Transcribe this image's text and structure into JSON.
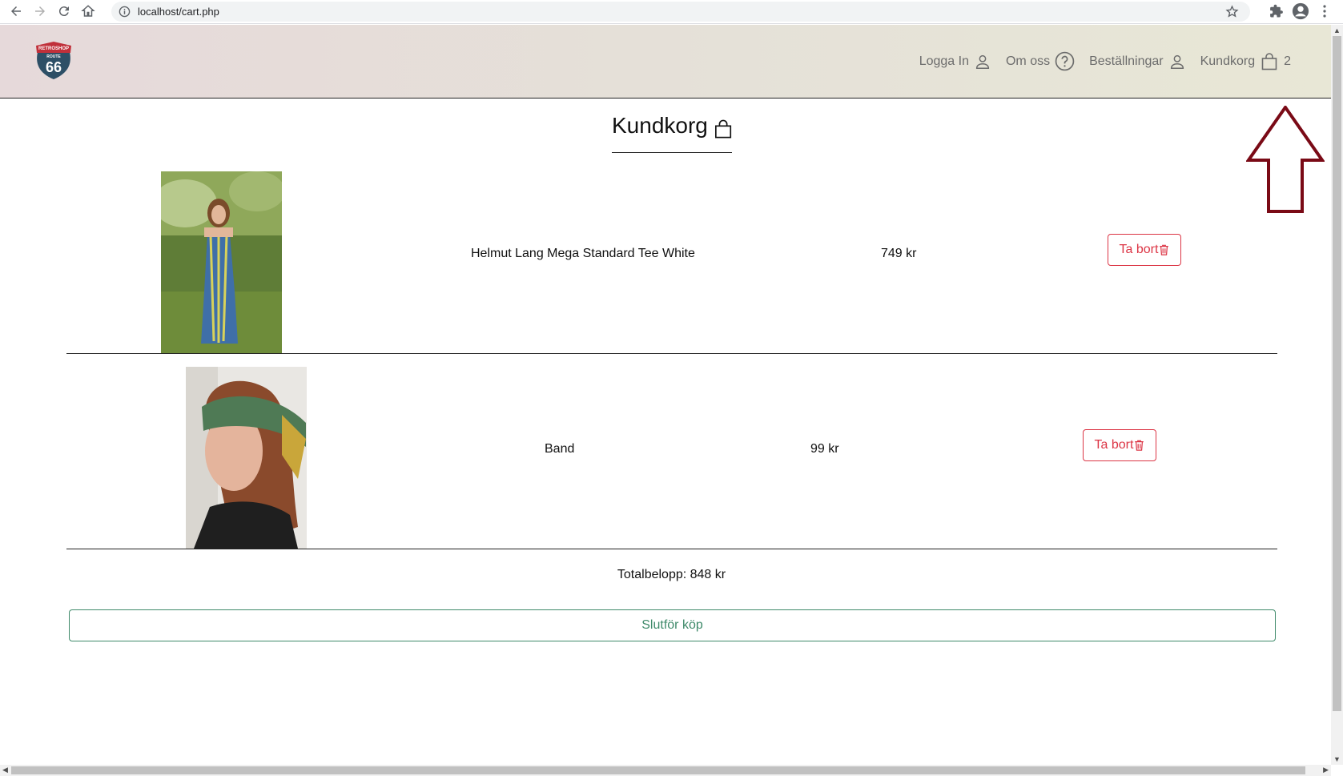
{
  "browser": {
    "url": "localhost/cart.php"
  },
  "header": {
    "logo": {
      "top_text": "RETROSHOP",
      "route_text": "ROUTE",
      "number": "66"
    },
    "nav": {
      "login": "Logga In",
      "about": "Om oss",
      "orders": "Beställningar",
      "cart": "Kundkorg",
      "cart_count": "2"
    }
  },
  "page": {
    "title": "Kundkorg"
  },
  "cart": {
    "items": [
      {
        "name": "Helmut Lang Mega Standard Tee White",
        "price": "749 kr",
        "remove_label": "Ta bort"
      },
      {
        "name": "Band",
        "price": "99 kr",
        "remove_label": "Ta bort"
      }
    ],
    "total": "Totalbelopp: 848 kr",
    "checkout_label": "Slutför köp"
  },
  "colors": {
    "remove": "#dc3545",
    "checkout": "#3f8a6a",
    "annotation_arrow": "#7a0a16"
  }
}
